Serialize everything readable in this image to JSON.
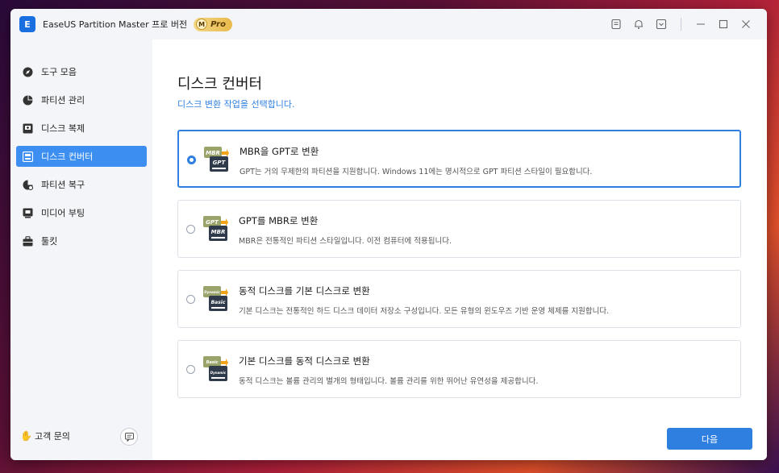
{
  "app": {
    "logo_letter": "E",
    "title": "EaseUS Partition Master 프로 버전",
    "pro_badge_letter": "M",
    "pro_badge": "Pro"
  },
  "titlebar_icons": [
    "notes-icon",
    "bell-icon",
    "menu-icon",
    "minimize-icon",
    "maximize-icon",
    "close-icon"
  ],
  "sidebar": {
    "items": [
      {
        "label": "도구 모음",
        "icon": "compass-icon",
        "active": false
      },
      {
        "label": "파티션 관리",
        "icon": "pie-icon",
        "active": false
      },
      {
        "label": "디스크 복제",
        "icon": "clone-icon",
        "active": false
      },
      {
        "label": "디스크 컨버터",
        "icon": "converter-icon",
        "active": true
      },
      {
        "label": "파티션 복구",
        "icon": "recovery-icon",
        "active": false
      },
      {
        "label": "미디어 부팅",
        "icon": "media-icon",
        "active": false
      },
      {
        "label": "툴킷",
        "icon": "toolkit-icon",
        "active": false
      }
    ],
    "support_label": "고객 문의"
  },
  "main": {
    "title": "디스크 컨버터",
    "subtitle": "디스크 변환 작업을 선택합니다.",
    "options": [
      {
        "title": "MBR을 GPT로 변환",
        "desc": "GPT는 거의 무제한의 파티션을 지원합니다. Windows 11에는 명시적으로 GPT 파티션 스타일이 필요합니다.",
        "selected": true,
        "icon_top": "MBR",
        "icon_bottom": "GPT"
      },
      {
        "title": "GPT를 MBR로 변환",
        "desc": "MBR은 전통적인 파티션 스타일입니다. 이전 컴퓨터에 적용됩니다.",
        "selected": false,
        "icon_top": "GPT",
        "icon_bottom": "MBR"
      },
      {
        "title": "동적 디스크를 기본 디스크로 변환",
        "desc": "기본 디스크는 전통적인 하드 디스크 데이터 저장소 구성입니다. 모든 유형의 윈도우즈 기반 운영 체제를 지원합니다.",
        "selected": false,
        "icon_top": "Dynamic",
        "icon_bottom": "Basic"
      },
      {
        "title": "기본 디스크를 동적 디스크로 변환",
        "desc": "동적 디스크는 볼륨 관리의 별개의 형태입니다. 볼륨 관리를 위한 뛰어난 유연성을 제공합니다.",
        "selected": false,
        "icon_top": "Basic",
        "icon_bottom": "Dynamic"
      }
    ],
    "next_label": "다음"
  },
  "colors": {
    "accent": "#2f7fe0",
    "sidebar_bg": "#f3f5f8",
    "active_nav": "#3c8ef0"
  }
}
